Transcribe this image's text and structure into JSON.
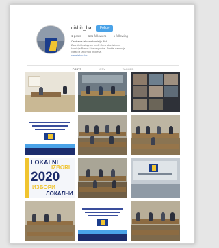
{
  "profile": {
    "username": "cikbih_ba",
    "follow_label": "Follow",
    "stats": [
      "1 posts",
      "181 followers",
      "1 following"
    ],
    "bio_lines": [
      "Centralna izborna komisija BiH",
      "Zvanični Instagram profil Centralne izborne komisije",
      "Bosne i Hercegovine. Pratite najnovije vijesti iz",
      "izbornog procesa.",
      "www.izbori.ba"
    ]
  },
  "tabs": [
    "POSTS",
    "IGTV",
    "TAGGED"
  ],
  "posts": [
    {
      "name": "post-office-meeting"
    },
    {
      "name": "post-conference-hall"
    },
    {
      "name": "post-video-call"
    },
    {
      "name": "post-poster-1"
    },
    {
      "name": "post-session-room-1"
    },
    {
      "name": "post-session-room-2"
    },
    {
      "name": "post-lokalni-izbori-2020"
    },
    {
      "name": "post-session-room-3"
    },
    {
      "name": "post-cik-logo-wall"
    },
    {
      "name": "post-session-room-4"
    },
    {
      "name": "post-poster-2"
    },
    {
      "name": "post-session-room-5"
    }
  ],
  "lokalni": {
    "line1": "LOKALNI",
    "line2": "IZBORI",
    "year": "2020",
    "line3": "ИЗБОРИ",
    "line4": "ЛОКАЛНИ"
  },
  "colors": {
    "accent": "#4aa3e8",
    "poster_blue": "#1c2c6c",
    "poster_yellow": "#f0c430"
  }
}
